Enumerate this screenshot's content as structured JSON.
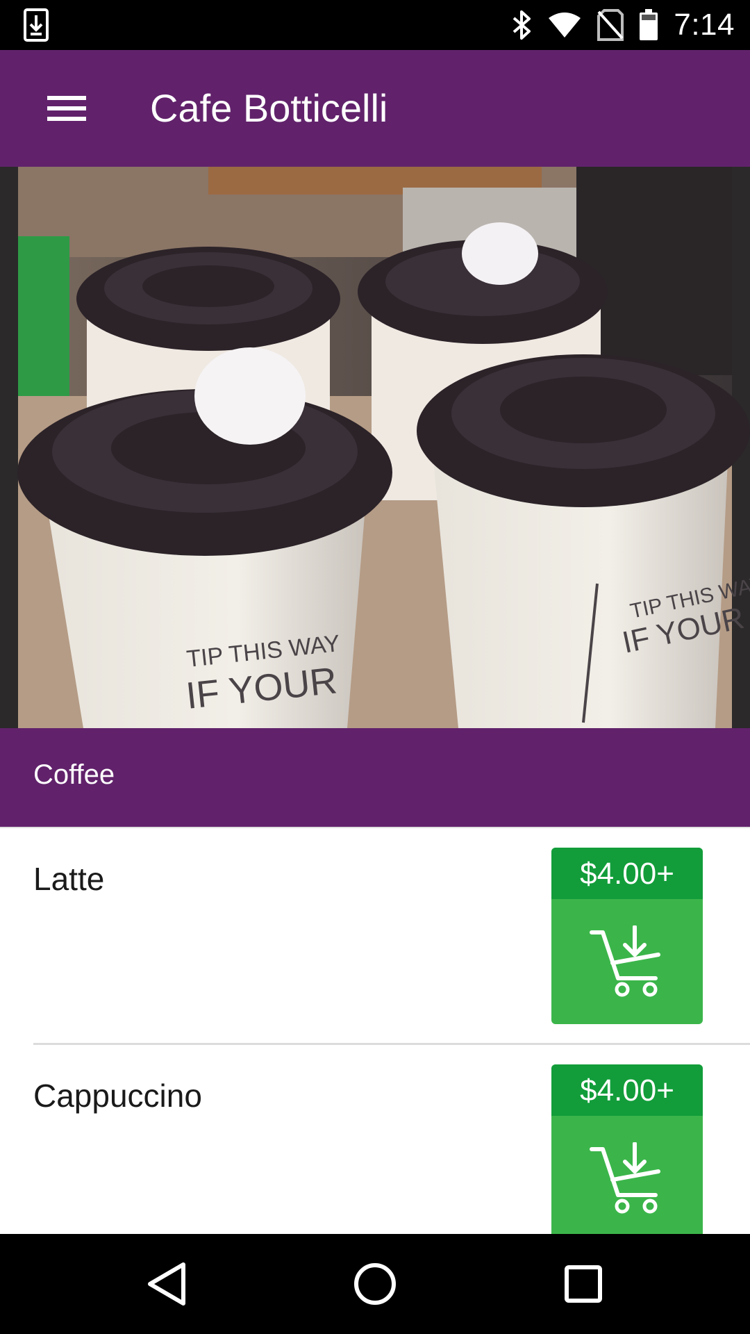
{
  "status_bar": {
    "time": "7:14",
    "left_icon": "download-notification-icon",
    "right_icons": [
      "bluetooth-icon",
      "wifi-icon",
      "no-sim-icon",
      "battery-icon"
    ]
  },
  "app_bar": {
    "title": "Cafe Botticelli",
    "menu_icon": "hamburger-menu-icon",
    "background": "#61226b"
  },
  "hero": {
    "image_description": "hero-image"
  },
  "category": {
    "label": "Coffee"
  },
  "items": [
    {
      "name": "Latte",
      "price": "$4.00+",
      "cart_icon": "add-to-cart-icon"
    },
    {
      "name": "Cappuccino",
      "price": "$4.00+",
      "cart_icon": "add-to-cart-icon"
    }
  ],
  "colors": {
    "primary": "#61226b",
    "price_bg": "#129d3a",
    "cart_bg": "#3bb54a"
  },
  "nav_bar": {
    "buttons": [
      "back-icon",
      "home-icon",
      "recents-icon"
    ]
  }
}
